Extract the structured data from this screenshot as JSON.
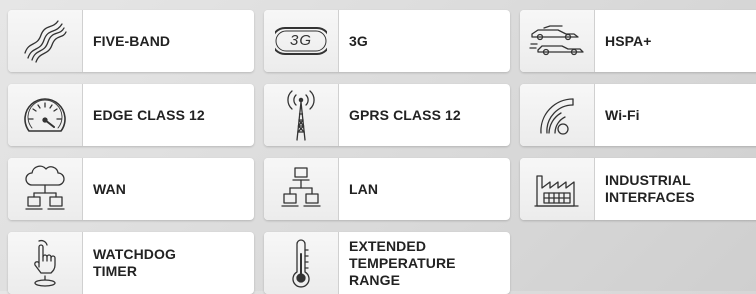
{
  "features": [
    {
      "label": "FIVE-BAND",
      "icon": "wavy-lines-icon"
    },
    {
      "label": "3G",
      "icon": "3g-icon",
      "badge": "3G"
    },
    {
      "label": "HSPA+",
      "icon": "speed-cars-icon"
    },
    {
      "label": "EDGE CLASS 12",
      "icon": "speedometer-icon"
    },
    {
      "label": "GPRS CLASS 12",
      "icon": "antenna-icon"
    },
    {
      "label": "Wi-Fi",
      "icon": "wifi-icon"
    },
    {
      "label": "WAN",
      "icon": "cloud-network-icon"
    },
    {
      "label": "LAN",
      "icon": "lan-icon"
    },
    {
      "label": "INDUSTRIAL\nINTERFACES",
      "icon": "factory-icon"
    },
    {
      "label": "WATCHDOG\nTIMER",
      "icon": "hand-press-icon"
    },
    {
      "label": "EXTENDED\nTEMPERATURE\nRANGE",
      "icon": "thermometer-icon"
    }
  ]
}
